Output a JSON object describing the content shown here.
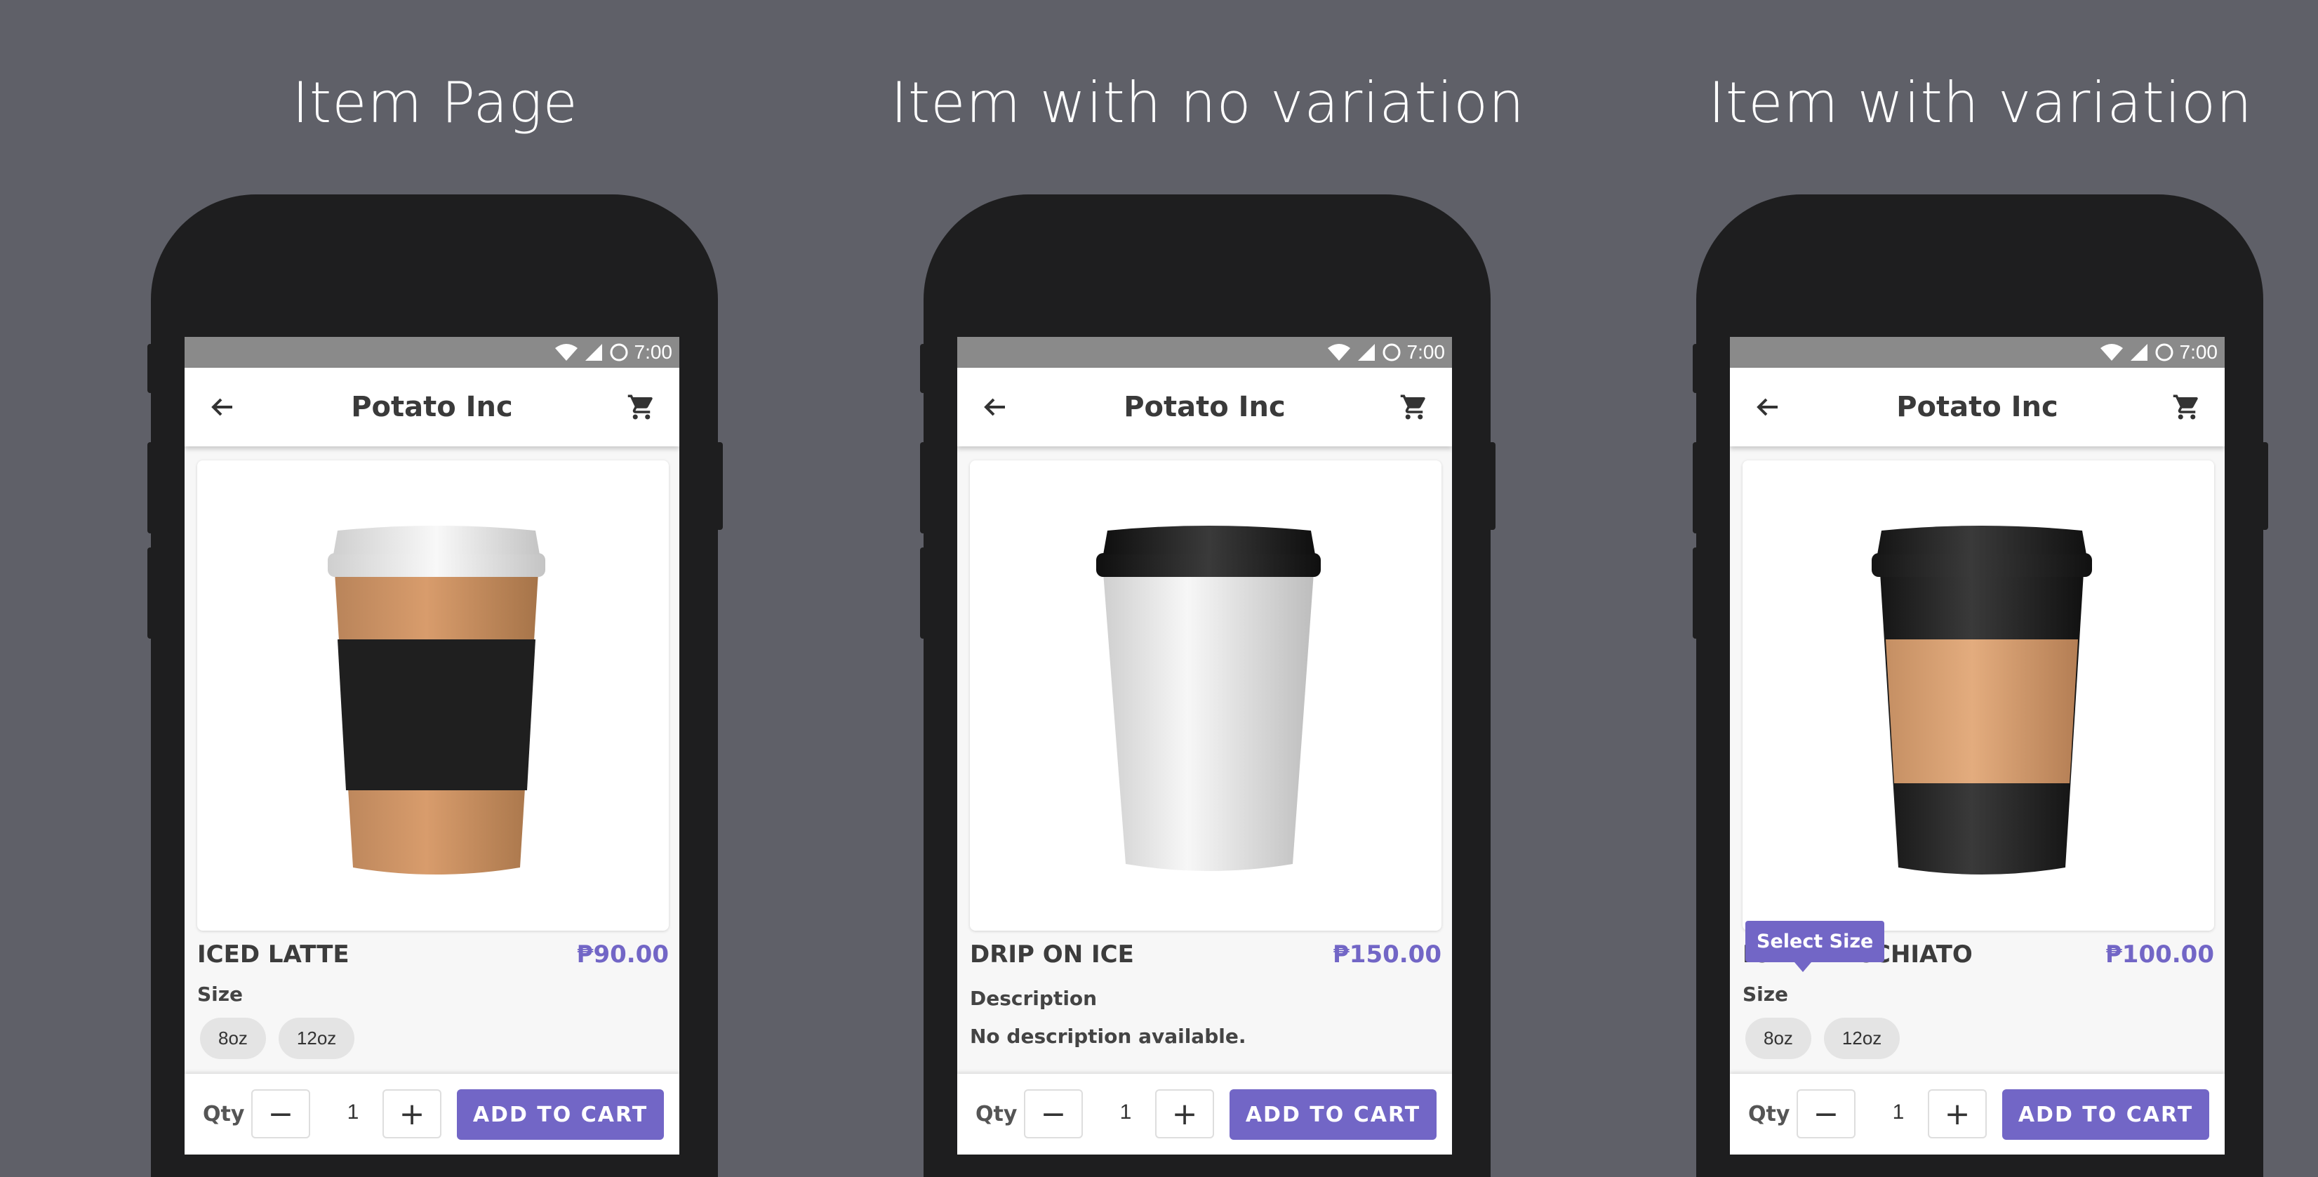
{
  "colors": {
    "background": "#5f6068",
    "accent": "#7266c6",
    "phone": "#1e1e1f"
  },
  "panels": [
    {
      "heading": "Item Page",
      "status": {
        "time": "7:00"
      },
      "appbar": {
        "title": "Potato Inc"
      },
      "item": {
        "name": "ICED LATTE",
        "price": "₱90.00",
        "cup": "iced-latte-cup"
      },
      "size_label": "Size",
      "sizes": [
        "8oz",
        "12oz"
      ],
      "bottom": {
        "qty_label": "Qty",
        "minus": "−",
        "qty": "1",
        "plus": "+",
        "add_to_cart": "ADD TO CART"
      }
    },
    {
      "heading": "Item with no variation",
      "status": {
        "time": "7:00"
      },
      "appbar": {
        "title": "Potato Inc"
      },
      "item": {
        "name": "DRIP ON ICE",
        "price": "₱150.00",
        "cup": "drip-cup"
      },
      "description_label": "Description",
      "description": "No description available.",
      "bottom": {
        "qty_label": "Qty",
        "minus": "−",
        "qty": "1",
        "plus": "+",
        "add_to_cart": "ADD TO CART"
      }
    },
    {
      "heading": "Item with variation",
      "status": {
        "time": "7:00"
      },
      "appbar": {
        "title": "Potato Inc"
      },
      "item": {
        "name": "ICED MACCHIATO",
        "price": "₱100.00",
        "cup": "macchiato-cup"
      },
      "tooltip": "Select Size",
      "size_label": "Size",
      "sizes": [
        "8oz",
        "12oz"
      ],
      "bottom": {
        "qty_label": "Qty",
        "minus": "−",
        "qty": "1",
        "plus": "+",
        "add_to_cart": "ADD TO CART"
      }
    }
  ]
}
